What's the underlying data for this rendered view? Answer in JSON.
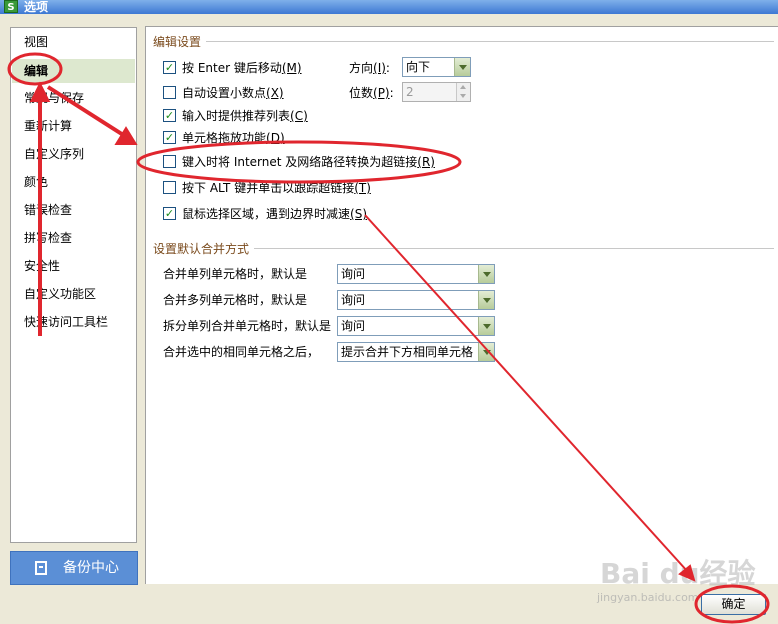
{
  "window": {
    "title": "选项",
    "app_icon": "S"
  },
  "sidebar": {
    "items": [
      {
        "label": "视图"
      },
      {
        "label": "编辑",
        "selected": true
      },
      {
        "label": "常规与保存"
      },
      {
        "label": "重新计算"
      },
      {
        "label": "自定义序列"
      },
      {
        "label": "颜色"
      },
      {
        "label": "错误检查"
      },
      {
        "label": "拼写检查"
      },
      {
        "label": "安全性"
      },
      {
        "label": "自定义功能区"
      },
      {
        "label": "快速访问工具栏"
      }
    ],
    "backup_label": "备份中心"
  },
  "edit_settings": {
    "title": "编辑设置",
    "options": [
      {
        "label": "按 Enter 键后移动",
        "key": "(M)",
        "checked": true
      },
      {
        "label": "自动设置小数点",
        "key": "(X)",
        "checked": false
      },
      {
        "label": "输入时提供推荐列表",
        "key": "(C)",
        "checked": true
      },
      {
        "label": "单元格拖放功能",
        "key": "(D)",
        "checked": true
      },
      {
        "label": "键入时将 Internet 及网络路径转换为超链接",
        "key": "(R)",
        "checked": false
      },
      {
        "label": "按下 ALT 键并单击以跟踪超链接",
        "key": "(T)",
        "checked": false
      },
      {
        "label": "鼠标选择区域，遇到边界时减速",
        "key": "(S)",
        "checked": true
      }
    ],
    "direction_label": "方向",
    "direction_key": "(I)",
    "direction_value": "向下",
    "digits_label": "位数",
    "digits_key": "(P)",
    "digits_value": "2"
  },
  "merge_settings": {
    "title": "设置默认合并方式",
    "rows": [
      {
        "label": "合并单列单元格时，默认是",
        "value": "询问"
      },
      {
        "label": "合并多列单元格时，默认是",
        "value": "询问"
      },
      {
        "label": "拆分单列合并单元格时，默认是",
        "value": "询问"
      },
      {
        "label": "合并选中的相同单元格之后，",
        "value": "提示合并下方相同单元格"
      }
    ]
  },
  "buttons": {
    "ok": "确定"
  },
  "watermark": {
    "main": "Bai du经验",
    "sub": "jingyan.baidu.com"
  },
  "colors": {
    "annotation": "#e0262e",
    "selected_bg": "#dde8cf",
    "backup_bg": "#5b8fd6"
  }
}
